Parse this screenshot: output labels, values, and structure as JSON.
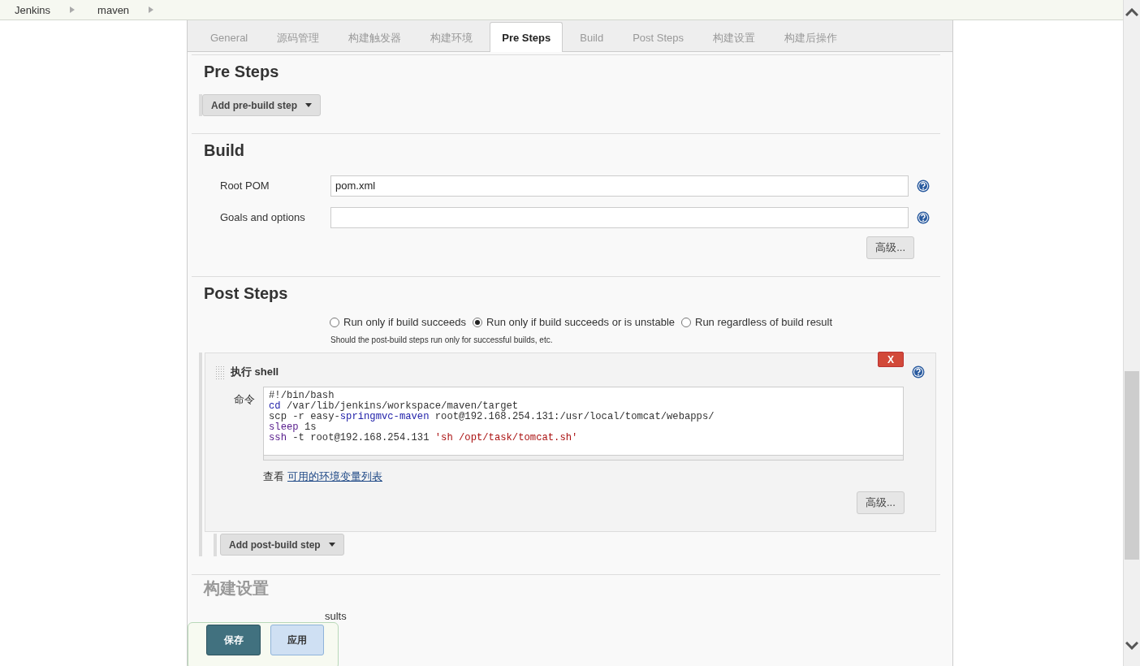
{
  "breadcrumb": [
    "Jenkins",
    "maven"
  ],
  "tabs": [
    {
      "label": "General",
      "selected": false
    },
    {
      "label": "源码管理",
      "selected": false
    },
    {
      "label": "构建触发器",
      "selected": false
    },
    {
      "label": "构建环境",
      "selected": false
    },
    {
      "label": "Pre Steps",
      "selected": true
    },
    {
      "label": "Build",
      "selected": false
    },
    {
      "label": "Post Steps",
      "selected": false
    },
    {
      "label": "构建设置",
      "selected": false
    },
    {
      "label": "构建后操作",
      "selected": false
    }
  ],
  "pre_steps": {
    "title": "Pre Steps",
    "add_button": "Add pre-build step"
  },
  "build": {
    "title": "Build",
    "fields": [
      {
        "label": "Root POM",
        "value": "pom.xml"
      },
      {
        "label": "Goals and options"
      }
    ],
    "advanced_button": "高级..."
  },
  "post_steps": {
    "title": "Post Steps",
    "options": [
      {
        "label": "Run only if build succeeds",
        "selected": false
      },
      {
        "label": "Run only if build succeeds or is unstable",
        "selected": true
      },
      {
        "label": "Run regardless of build result",
        "selected": false
      }
    ],
    "hint": "Should the post-build steps run only for successful builds, etc.",
    "step": {
      "title": "执行 shell",
      "delete_label": "X",
      "command_label": "命令",
      "code_lines": [
        [
          {
            "text": "#!/bin/bash",
            "kind": "plain"
          }
        ],
        [
          {
            "text": "cd",
            "kind": "keyword"
          },
          {
            "text": " /var/lib/jenkins/workspace/maven/target",
            "kind": "plain"
          }
        ],
        [
          {
            "text": "scp -r easy-",
            "kind": "plain"
          },
          {
            "text": "springmvc-maven",
            "kind": "keyword"
          },
          {
            "text": " root@192.168.254.131:/usr/local/tomcat/webapps/",
            "kind": "plain"
          }
        ],
        [
          {
            "text": "sleep",
            "kind": "builtin"
          },
          {
            "text": " 1s",
            "kind": "plain"
          }
        ],
        [
          {
            "text": "ssh",
            "kind": "builtin"
          },
          {
            "text": " -t root@192.168.254.131 ",
            "kind": "plain"
          },
          {
            "text": "'sh /opt/task/tomcat.sh'",
            "kind": "string"
          }
        ]
      ],
      "env_prefix": "查看",
      "env_link": "可用的环境变量列表",
      "advanced_button": "高级..."
    },
    "add_button": "Add post-build step"
  },
  "next_section": {
    "title": "构建设置",
    "checkbox": {
      "label": "sults"
    }
  },
  "action_bar": {
    "save": "保存",
    "apply": "应用"
  }
}
